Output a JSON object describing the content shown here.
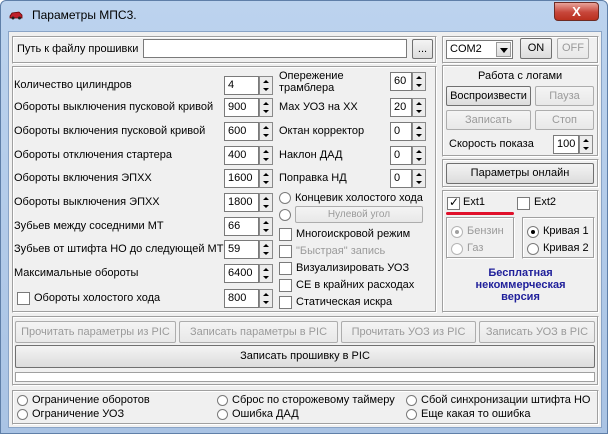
{
  "window": {
    "title": "Параметры МПС3.",
    "close_label": "X"
  },
  "firmware": {
    "path_label": "Путь к файлу прошивки",
    "path_value": "",
    "browse_label": "...",
    "com_port": "COM2",
    "on_label": "ON",
    "off_label": "OFF"
  },
  "params_left": [
    {
      "label": "Количество цилиндров",
      "value": "4"
    },
    {
      "label": "Обороты выключения пусковой кривой",
      "value": "900"
    },
    {
      "label": "Обороты включения пусковой кривой",
      "value": "600"
    },
    {
      "label": "Обороты отключения стартера",
      "value": "400"
    },
    {
      "label": "Обороты включения ЭПХХ",
      "value": "1600"
    },
    {
      "label": "Обороты выключения ЭПХХ",
      "value": "1800"
    },
    {
      "label": "Зубьев между соседними МТ",
      "value": "66"
    },
    {
      "label": "Зубьев от штифта НО до следующей МТ",
      "value": "59"
    },
    {
      "label": "Максимальные обороты",
      "value": "6400"
    }
  ],
  "idle_speed": {
    "label": "Обороты холостого хода",
    "value": "800",
    "checked": false
  },
  "params_mid": [
    {
      "label": "Опережение трамблера",
      "value": "60"
    },
    {
      "label": "Мах УОЗ на ХХ",
      "value": "20"
    },
    {
      "label": "Октан корректор",
      "value": "0"
    },
    {
      "label": "Наклон ДАД",
      "value": "0"
    },
    {
      "label": "Поправка НД",
      "value": "0"
    }
  ],
  "idle_switch": {
    "label": "Концевик холостого хода",
    "zero_angle_label": "Нулевой угол"
  },
  "options": [
    {
      "label": "Многоискровой режим",
      "checked": false,
      "disabled": false
    },
    {
      "label": "\"Быстрая\" запись",
      "checked": false,
      "disabled": true
    },
    {
      "label": "Визуализировать УОЗ",
      "checked": false,
      "disabled": false
    },
    {
      "label": "СЕ в крайних расходах",
      "checked": false,
      "disabled": false
    },
    {
      "label": "Статическая искра",
      "checked": false,
      "disabled": false
    }
  ],
  "logs": {
    "title": "Работа с логами",
    "play_label": "Воспроизвести",
    "pause_label": "Пауза",
    "record_label": "Записать",
    "stop_label": "Стоп",
    "speed_label": "Скорость показа",
    "speed_value": "100"
  },
  "online": {
    "label": "Параметры  онлайн"
  },
  "ext": {
    "ext1_label": "Ext1",
    "ext1_checked": true,
    "ext2_label": "Ext2",
    "ext2_checked": false,
    "fuel1": "Бензин",
    "fuel2": "Газ",
    "curve1": "Кривая 1",
    "curve2": "Кривая 2"
  },
  "free_note": {
    "line1": "Бесплатная",
    "line2": "некоммерческая",
    "line3": "версия"
  },
  "actions": {
    "read_pic": "Прочитать параметры из PIC",
    "write_pic": "Записать параметры в PIC",
    "read_uoz": "Прочитать УОЗ из PIC",
    "write_uoz": "Записать УОЗ в PIC",
    "flash": "Записать прошивку в PIC"
  },
  "status": [
    "Ограничение оборотов",
    "Сброс по сторожевому таймеру",
    "Сбой синхронизации штифта НО",
    "Ограничение УОЗ",
    "Ошибка ДАД",
    "Еще какая то ошибка"
  ],
  "colors": {
    "accent_text": "#1f1f9a",
    "marker": "#e0102a"
  }
}
